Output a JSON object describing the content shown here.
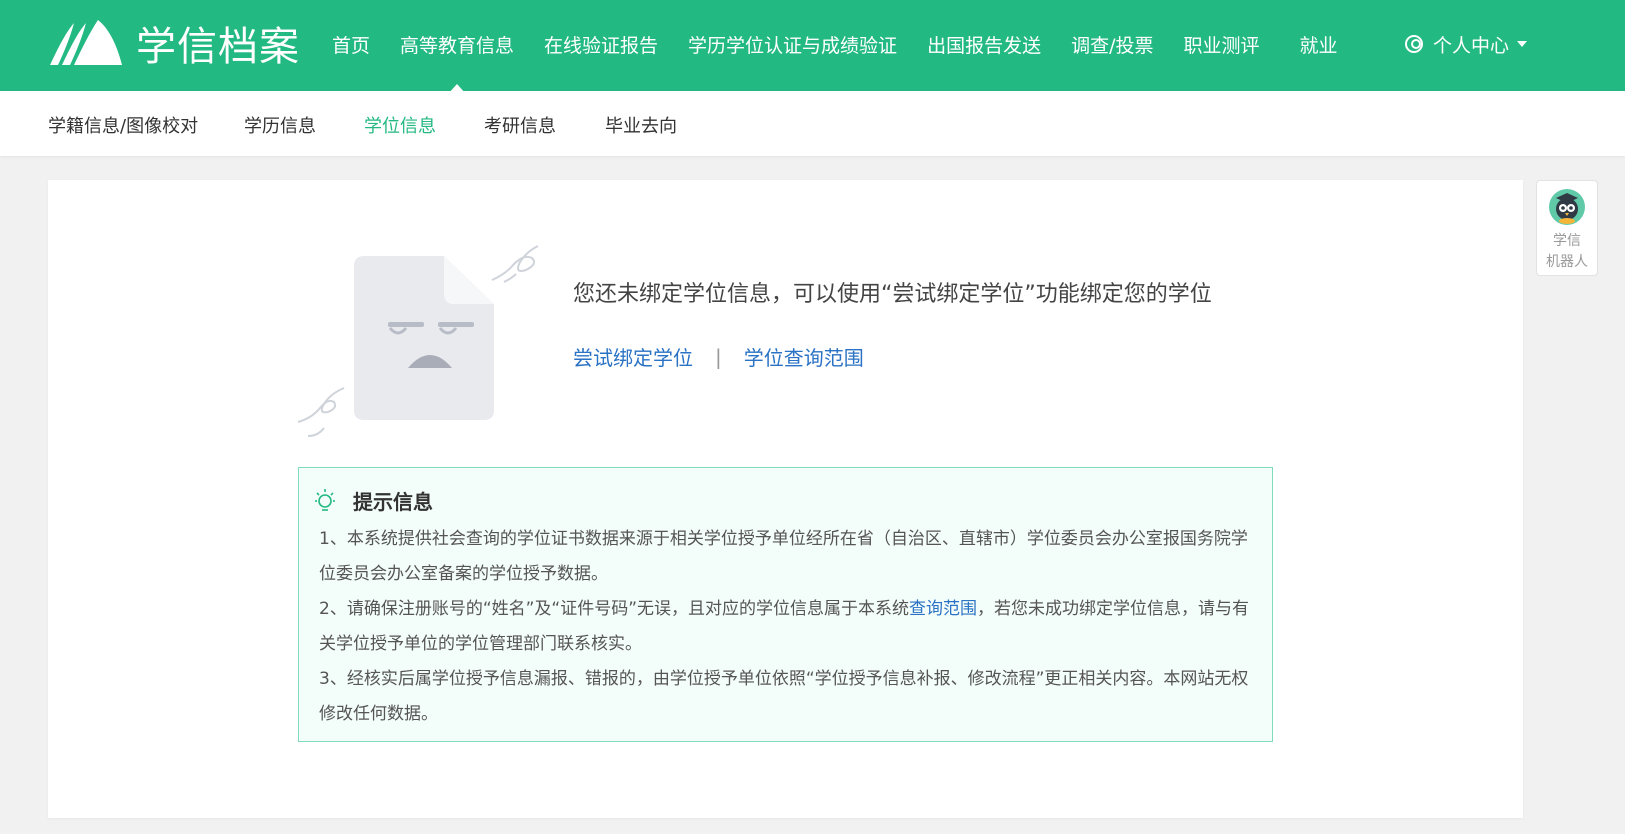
{
  "header": {
    "logo_text": "学信档案",
    "nav": [
      "首页",
      "高等教育信息",
      "在线验证报告",
      "学历学位认证与成绩验证",
      "出国报告发送",
      "调查/投票",
      "职业测评",
      "就业"
    ],
    "user_menu_label": "个人中心"
  },
  "subnav": [
    "学籍信息/图像校对",
    "学历信息",
    "学位信息",
    "考研信息",
    "毕业去向"
  ],
  "main": {
    "headline": "您还未绑定学位信息，可以使用“尝试绑定学位”功能绑定您的学位",
    "bind_link": "尝试绑定学位",
    "separator": "|",
    "scope_link": "学位查询范围"
  },
  "tips": {
    "title": "提示信息",
    "item1": "1、本系统提供社会查询的学位证书数据来源于相关学位授予单位经所在省（自治区、直辖市）学位委员会办公室报国务院学位委员会办公室备案的学位授予数据。",
    "item2_before": "2、请确保注册账号的“姓名”及“证件号码”无误，且对应的学位信息属于本系统",
    "item2_link": "查询范围",
    "item2_after": "，若您未成功绑定学位信息，请与有关学位授予单位的学位管理部门联系核实。",
    "item3": "3、经核实后属学位授予信息漏报、错报的，由学位授予单位依照“学位授予信息补报、修改流程”更正相关内容。本网站无权修改任何数据。"
  },
  "robot": {
    "line1": "学信",
    "line2": "机器人"
  },
  "colors": {
    "brand": "#23b982",
    "link": "#2a72c4",
    "tips_bg": "#f3fdf9",
    "tips_border": "#7fdcbb"
  }
}
